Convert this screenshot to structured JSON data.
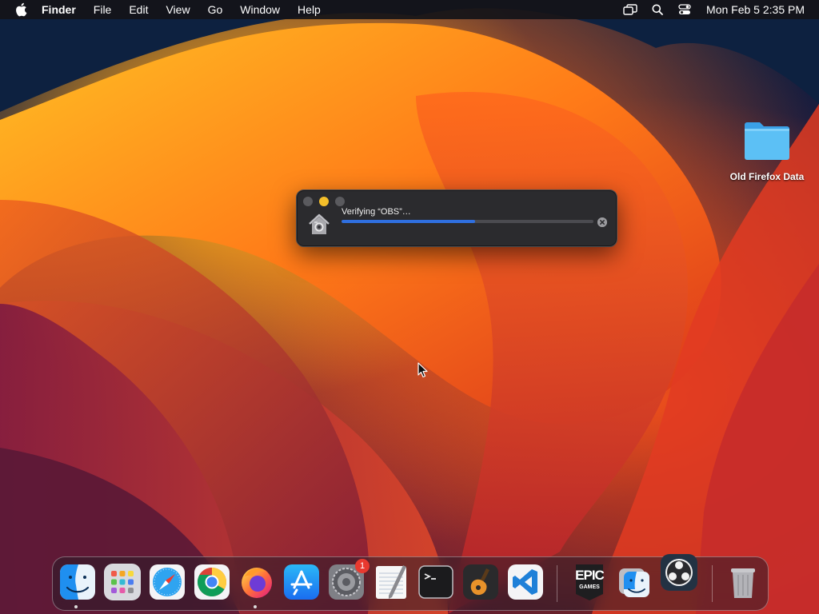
{
  "menubar": {
    "app_name": "Finder",
    "items": [
      "File",
      "Edit",
      "View",
      "Go",
      "Window",
      "Help"
    ],
    "clock": "Mon Feb 5  2:35 PM",
    "status_icons": [
      "screen-mirroring-icon",
      "spotlight-search-icon",
      "control-center-icon"
    ]
  },
  "desktop": {
    "folder_label": "Old Firefox Data"
  },
  "verify_dialog": {
    "title": "Verifying “OBS”…",
    "progress": 0.53,
    "progress_color": "#2f6fe0"
  },
  "dock": {
    "items": [
      {
        "name": "finder",
        "running": true
      },
      {
        "name": "launchpad",
        "running": false
      },
      {
        "name": "safari",
        "running": false
      },
      {
        "name": "chrome",
        "running": false
      },
      {
        "name": "firefox",
        "running": true
      },
      {
        "name": "app-store",
        "running": false
      },
      {
        "name": "system-settings",
        "running": false,
        "badge": "1"
      },
      {
        "name": "textedit",
        "running": false
      },
      {
        "name": "terminal",
        "running": false
      },
      {
        "name": "garageband",
        "running": false
      },
      {
        "name": "vscode",
        "running": false
      },
      {
        "name": "epic-games",
        "running": false,
        "label_top": "EPIC",
        "label_bottom": "GAMES"
      },
      {
        "name": "finder-2",
        "running": false
      },
      {
        "name": "obs",
        "running": false
      },
      {
        "name": "trash",
        "running": false
      }
    ]
  }
}
